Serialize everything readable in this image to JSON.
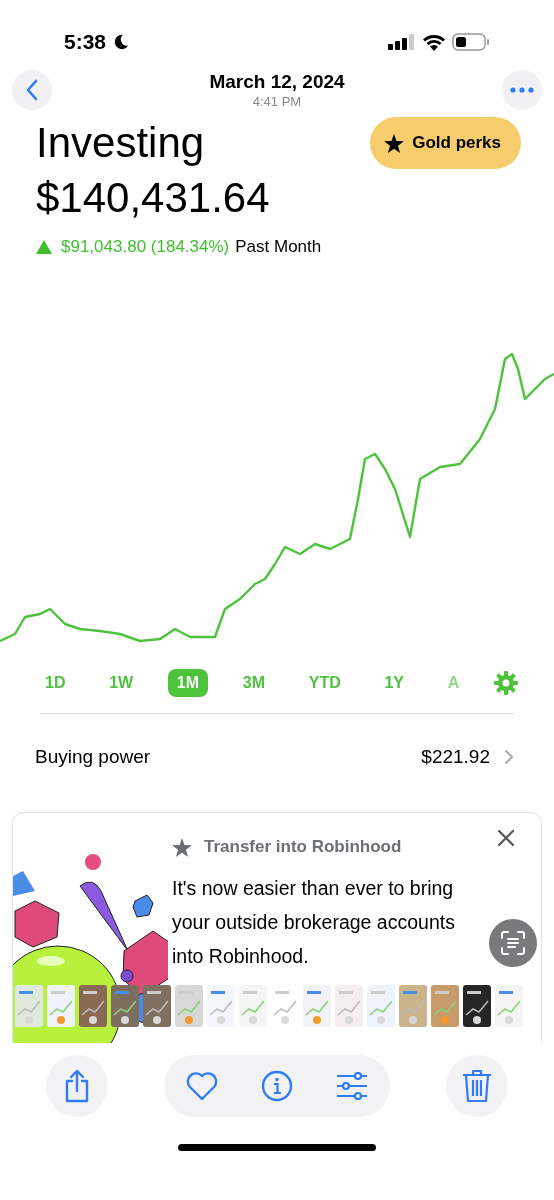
{
  "status_bar": {
    "time": "5:38"
  },
  "header": {
    "date": "March 12, 2024",
    "time": "4:41 PM"
  },
  "title": "Investing",
  "badge": {
    "label": "Gold perks"
  },
  "balance": "$140,431.64",
  "change": {
    "amount": "$91,043.80 (184.34%)",
    "period": "Past Month"
  },
  "ranges": [
    {
      "label": "1D",
      "selected": false,
      "faded": false
    },
    {
      "label": "1W",
      "selected": false,
      "faded": false
    },
    {
      "label": "1M",
      "selected": true,
      "faded": false
    },
    {
      "label": "3M",
      "selected": false,
      "faded": false
    },
    {
      "label": "YTD",
      "selected": false,
      "faded": false
    },
    {
      "label": "1Y",
      "selected": false,
      "faded": false
    },
    {
      "label": "A",
      "selected": false,
      "faded": true
    }
  ],
  "buying_power": {
    "label": "Buying power",
    "value": "$221.92"
  },
  "promo": {
    "title": "Transfer into Robinhood",
    "body": "It's now easier than ever to bring your outside brokerage accounts into Robinhood."
  }
}
